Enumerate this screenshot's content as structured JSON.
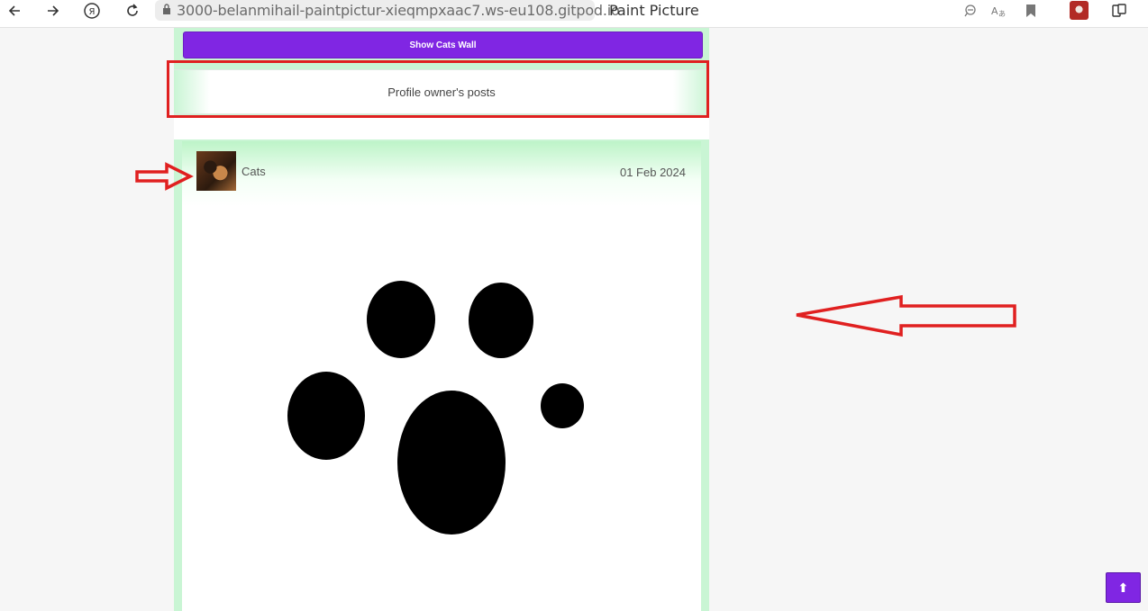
{
  "browser": {
    "url": "3000-belanmihail-paintpictur-xieqmpxaac7.ws-eu108.gitpod.io",
    "page_title": "Paint Picture",
    "icons": [
      "back-icon",
      "forward-icon",
      "yandex-icon",
      "reload-icon",
      "lock-icon",
      "zoom-icon",
      "translate-icon",
      "bookmark-icon",
      "profile-avatar",
      "downloads-icon"
    ]
  },
  "main": {
    "show_wall_label": "Show Cats Wall",
    "owner_posts_label": "Profile owner's posts"
  },
  "post": {
    "author": "Cats",
    "date": "01 Feb 2024",
    "image": "cat-paw-drawing"
  },
  "colors": {
    "accent": "#8026e3",
    "column_bg": "#c9f5d4",
    "annotation": "#e02020"
  },
  "scroll_top": {
    "icon": "arrow-up-icon",
    "label": "⬆"
  }
}
